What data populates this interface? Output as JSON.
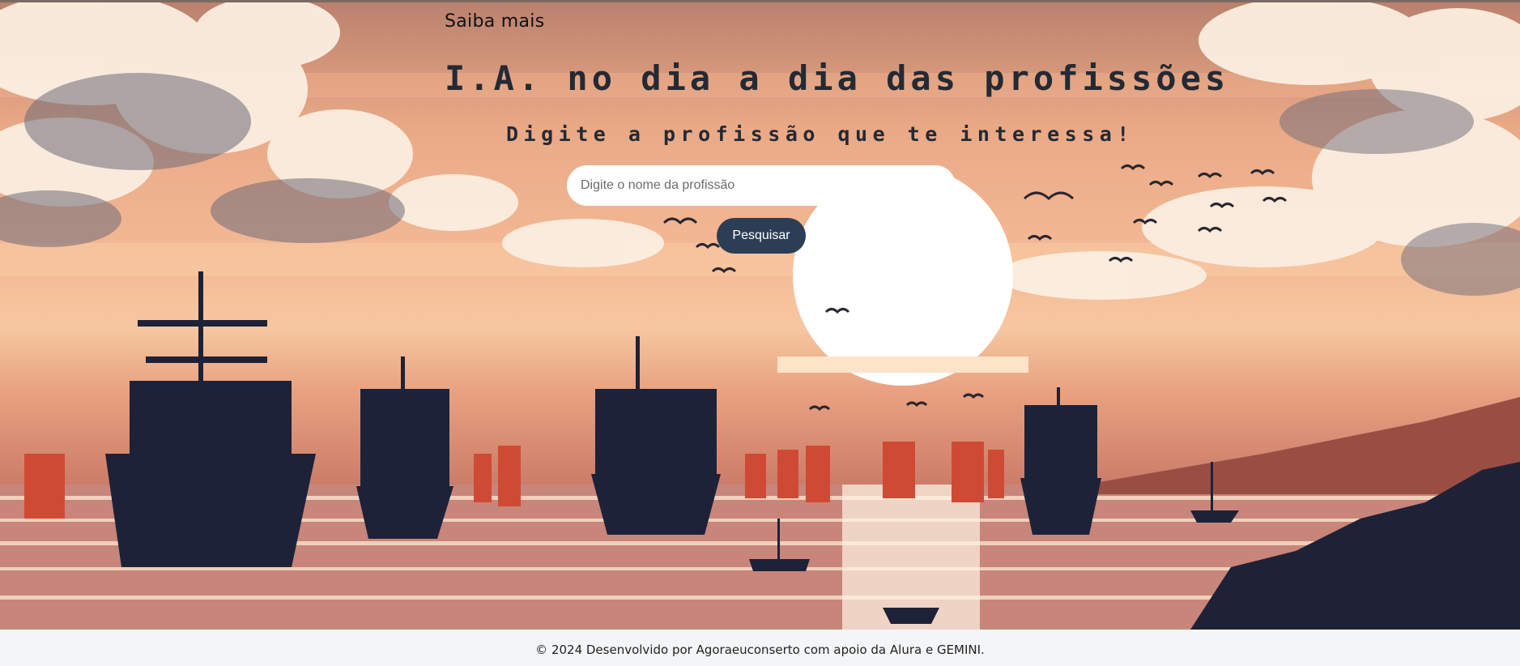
{
  "header": {
    "nav_link": "Saiba mais"
  },
  "main": {
    "title": "I.A. no dia a dia das profissões",
    "subtitle": "Digite a profissão que te interessa!",
    "search": {
      "placeholder": "Digite o nome da profissão",
      "value": "",
      "button_label": "Pesquisar"
    }
  },
  "footer": {
    "text": "© 2024 Desenvolvido por Agoraeuconserto com apoio da Alura e GEMINI."
  },
  "colors": {
    "button_bg": "#2c3e55",
    "title_text": "#232a33",
    "footer_bg": "#f4f5f7",
    "sun": "#ffffff"
  }
}
